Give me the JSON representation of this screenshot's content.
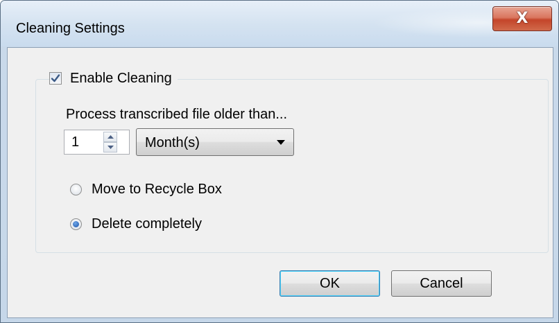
{
  "window": {
    "title": "Cleaning Settings",
    "close_glyph": "X"
  },
  "group": {
    "enable_label": "Enable Cleaning",
    "enable_checked": true
  },
  "age": {
    "prompt": "Process transcribed file older than...",
    "amount": "1",
    "unit": "Month(s)"
  },
  "action": {
    "options": [
      {
        "label": "Move to Recycle Box",
        "selected": false
      },
      {
        "label": "Delete completely",
        "selected": true
      }
    ]
  },
  "buttons": {
    "ok": "OK",
    "cancel": "Cancel"
  },
  "icons": {
    "close": "close-icon",
    "check": "check-icon",
    "spin_up": "arrow-up-icon",
    "spin_down": "arrow-down-icon",
    "dropdown": "chevron-down-icon"
  },
  "colors": {
    "close_button": "#c4452a",
    "radio_dot": "#1b53a8",
    "default_button_border": "#3c7fb1"
  }
}
